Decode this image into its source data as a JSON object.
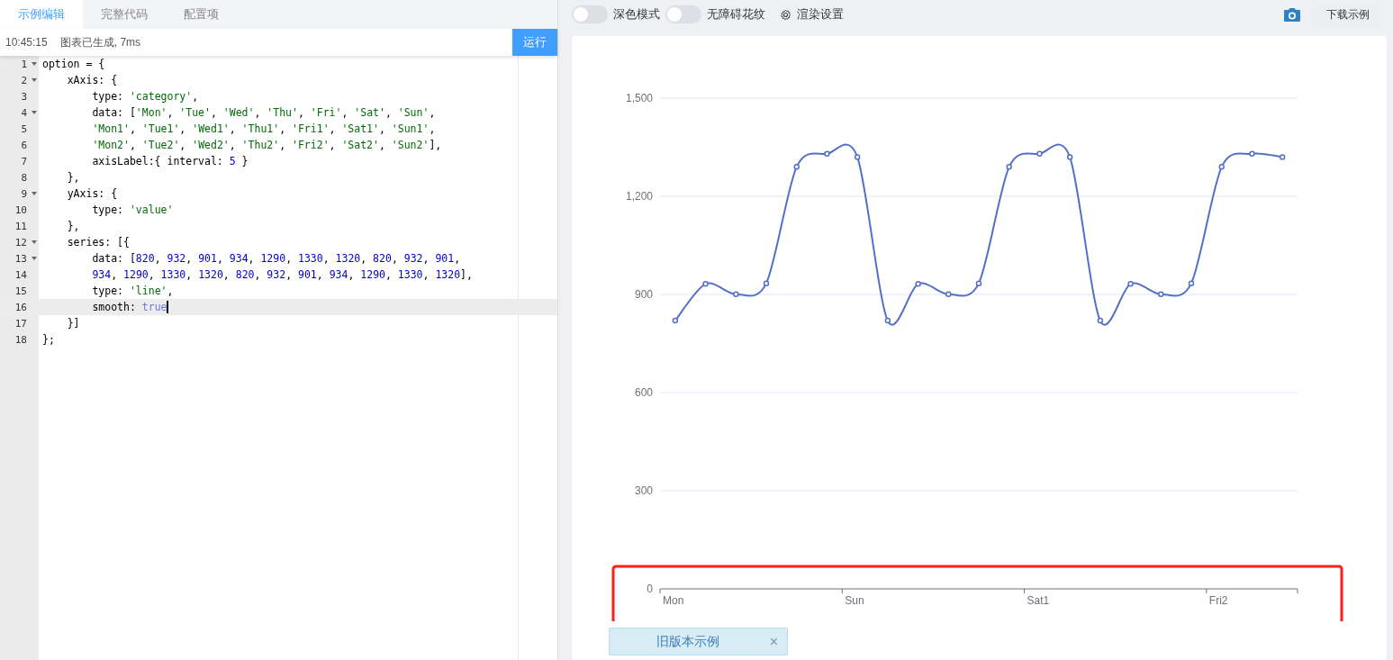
{
  "editor_tabs": [
    {
      "label": "示例编辑",
      "selected": true
    },
    {
      "label": "完整代码",
      "selected": false
    },
    {
      "label": "配置项",
      "selected": false
    }
  ],
  "status": {
    "time": "10:45:15",
    "message": "图表已生成, 7ms",
    "run_button": "运行"
  },
  "code_lines": [
    {
      "number": "1",
      "fold": true,
      "active": false,
      "tokens": [
        {
          "kind": "plain",
          "text": "option = {"
        }
      ]
    },
    {
      "number": "2",
      "fold": true,
      "active": false,
      "tokens": [
        {
          "kind": "plain",
          "text": "    xAxis: {"
        }
      ]
    },
    {
      "number": "3",
      "fold": false,
      "active": false,
      "tokens": [
        {
          "kind": "plain",
          "text": "        type: "
        },
        {
          "kind": "string",
          "text": "'category'"
        },
        {
          "kind": "plain",
          "text": ","
        }
      ]
    },
    {
      "number": "4",
      "fold": true,
      "active": false,
      "tokens": [
        {
          "kind": "plain",
          "text": "        data: ["
        },
        {
          "kind": "string",
          "text": "'Mon'"
        },
        {
          "kind": "plain",
          "text": ", "
        },
        {
          "kind": "string",
          "text": "'Tue'"
        },
        {
          "kind": "plain",
          "text": ", "
        },
        {
          "kind": "string",
          "text": "'Wed'"
        },
        {
          "kind": "plain",
          "text": ", "
        },
        {
          "kind": "string",
          "text": "'Thu'"
        },
        {
          "kind": "plain",
          "text": ", "
        },
        {
          "kind": "string",
          "text": "'Fri'"
        },
        {
          "kind": "plain",
          "text": ", "
        },
        {
          "kind": "string",
          "text": "'Sat'"
        },
        {
          "kind": "plain",
          "text": ", "
        },
        {
          "kind": "string",
          "text": "'Sun'"
        },
        {
          "kind": "plain",
          "text": ","
        }
      ]
    },
    {
      "number": "5",
      "fold": false,
      "active": false,
      "tokens": [
        {
          "kind": "string",
          "text": "        'Mon1'"
        },
        {
          "kind": "plain",
          "text": ", "
        },
        {
          "kind": "string",
          "text": "'Tue1'"
        },
        {
          "kind": "plain",
          "text": ", "
        },
        {
          "kind": "string",
          "text": "'Wed1'"
        },
        {
          "kind": "plain",
          "text": ", "
        },
        {
          "kind": "string",
          "text": "'Thu1'"
        },
        {
          "kind": "plain",
          "text": ", "
        },
        {
          "kind": "string",
          "text": "'Fri1'"
        },
        {
          "kind": "plain",
          "text": ", "
        },
        {
          "kind": "string",
          "text": "'Sat1'"
        },
        {
          "kind": "plain",
          "text": ", "
        },
        {
          "kind": "string",
          "text": "'Sun1'"
        },
        {
          "kind": "plain",
          "text": ","
        }
      ]
    },
    {
      "number": "6",
      "fold": false,
      "active": false,
      "tokens": [
        {
          "kind": "string",
          "text": "        'Mon2'"
        },
        {
          "kind": "plain",
          "text": ", "
        },
        {
          "kind": "string",
          "text": "'Tue2'"
        },
        {
          "kind": "plain",
          "text": ", "
        },
        {
          "kind": "string",
          "text": "'Wed2'"
        },
        {
          "kind": "plain",
          "text": ", "
        },
        {
          "kind": "string",
          "text": "'Thu2'"
        },
        {
          "kind": "plain",
          "text": ", "
        },
        {
          "kind": "string",
          "text": "'Fri2'"
        },
        {
          "kind": "plain",
          "text": ", "
        },
        {
          "kind": "string",
          "text": "'Sat2'"
        },
        {
          "kind": "plain",
          "text": ", "
        },
        {
          "kind": "string",
          "text": "'Sun2'"
        },
        {
          "kind": "plain",
          "text": "],"
        }
      ]
    },
    {
      "number": "7",
      "fold": false,
      "active": false,
      "tokens": [
        {
          "kind": "plain",
          "text": "        axisLabel:{ interval: "
        },
        {
          "kind": "number",
          "text": "5"
        },
        {
          "kind": "plain",
          "text": " }"
        }
      ]
    },
    {
      "number": "8",
      "fold": false,
      "active": false,
      "tokens": [
        {
          "kind": "plain",
          "text": "    },"
        }
      ]
    },
    {
      "number": "9",
      "fold": true,
      "active": false,
      "tokens": [
        {
          "kind": "plain",
          "text": "    yAxis: {"
        }
      ]
    },
    {
      "number": "10",
      "fold": false,
      "active": false,
      "tokens": [
        {
          "kind": "plain",
          "text": "        type: "
        },
        {
          "kind": "string",
          "text": "'value'"
        }
      ]
    },
    {
      "number": "11",
      "fold": false,
      "active": false,
      "tokens": [
        {
          "kind": "plain",
          "text": "    },"
        }
      ]
    },
    {
      "number": "12",
      "fold": true,
      "active": false,
      "tokens": [
        {
          "kind": "plain",
          "text": "    series: [{"
        }
      ]
    },
    {
      "number": "13",
      "fold": true,
      "active": false,
      "tokens": [
        {
          "kind": "plain",
          "text": "        data: ["
        },
        {
          "kind": "number",
          "text": "820"
        },
        {
          "kind": "plain",
          "text": ", "
        },
        {
          "kind": "number",
          "text": "932"
        },
        {
          "kind": "plain",
          "text": ", "
        },
        {
          "kind": "number",
          "text": "901"
        },
        {
          "kind": "plain",
          "text": ", "
        },
        {
          "kind": "number",
          "text": "934"
        },
        {
          "kind": "plain",
          "text": ", "
        },
        {
          "kind": "number",
          "text": "1290"
        },
        {
          "kind": "plain",
          "text": ", "
        },
        {
          "kind": "number",
          "text": "1330"
        },
        {
          "kind": "plain",
          "text": ", "
        },
        {
          "kind": "number",
          "text": "1320"
        },
        {
          "kind": "plain",
          "text": ", "
        },
        {
          "kind": "number",
          "text": "820"
        },
        {
          "kind": "plain",
          "text": ", "
        },
        {
          "kind": "number",
          "text": "932"
        },
        {
          "kind": "plain",
          "text": ", "
        },
        {
          "kind": "number",
          "text": "901"
        },
        {
          "kind": "plain",
          "text": ","
        }
      ]
    },
    {
      "number": "14",
      "fold": false,
      "active": false,
      "tokens": [
        {
          "kind": "number",
          "text": "        934"
        },
        {
          "kind": "plain",
          "text": ", "
        },
        {
          "kind": "number",
          "text": "1290"
        },
        {
          "kind": "plain",
          "text": ", "
        },
        {
          "kind": "number",
          "text": "1330"
        },
        {
          "kind": "plain",
          "text": ", "
        },
        {
          "kind": "number",
          "text": "1320"
        },
        {
          "kind": "plain",
          "text": ", "
        },
        {
          "kind": "number",
          "text": "820"
        },
        {
          "kind": "plain",
          "text": ", "
        },
        {
          "kind": "number",
          "text": "932"
        },
        {
          "kind": "plain",
          "text": ", "
        },
        {
          "kind": "number",
          "text": "901"
        },
        {
          "kind": "plain",
          "text": ", "
        },
        {
          "kind": "number",
          "text": "934"
        },
        {
          "kind": "plain",
          "text": ", "
        },
        {
          "kind": "number",
          "text": "1290"
        },
        {
          "kind": "plain",
          "text": ", "
        },
        {
          "kind": "number",
          "text": "1330"
        },
        {
          "kind": "plain",
          "text": ", "
        },
        {
          "kind": "number",
          "text": "1320"
        },
        {
          "kind": "plain",
          "text": "],"
        }
      ]
    },
    {
      "number": "15",
      "fold": false,
      "active": false,
      "tokens": [
        {
          "kind": "plain",
          "text": "        type: "
        },
        {
          "kind": "string",
          "text": "'line'"
        },
        {
          "kind": "plain",
          "text": ","
        }
      ]
    },
    {
      "number": "16",
      "fold": false,
      "active": true,
      "tokens": [
        {
          "kind": "plain",
          "text": "        smooth: "
        },
        {
          "kind": "keyword",
          "text": "true"
        }
      ]
    },
    {
      "number": "17",
      "fold": false,
      "active": false,
      "tokens": [
        {
          "kind": "plain",
          "text": "    }]"
        }
      ]
    },
    {
      "number": "18",
      "fold": false,
      "active": false,
      "tokens": [
        {
          "kind": "plain",
          "text": "};"
        }
      ]
    }
  ],
  "toolbar": {
    "toggles": [
      {
        "label": "深色模式",
        "on": false
      },
      {
        "label": "无障碍花纹",
        "on": false
      }
    ],
    "render_settings": "渲染设置",
    "download_button": "下载示例"
  },
  "chart": {
    "chart_data": {
      "type": "line",
      "categories": [
        "Mon",
        null,
        null,
        null,
        null,
        null,
        "Sun",
        null,
        null,
        null,
        null,
        null,
        "Sat1",
        null,
        null,
        null,
        null,
        null,
        "Fri2",
        null,
        null
      ],
      "series": [
        {
          "color": "#5470c6",
          "marker": true,
          "values": [
            820,
            932,
            901,
            934,
            1290,
            1330,
            1320,
            820,
            932,
            901,
            934,
            1290,
            1330,
            1320,
            820,
            932,
            901,
            934,
            1290,
            1330,
            1320
          ]
        }
      ],
      "grid": true,
      "ylim": [
        0,
        1500
      ],
      "yticks": [
        {
          "value": 0,
          "label": "0"
        },
        {
          "value": 300,
          "label": "300"
        },
        {
          "value": 600,
          "label": "600"
        },
        {
          "value": 900,
          "label": "900"
        },
        {
          "value": 1200,
          "label": "1,200"
        },
        {
          "value": 1500,
          "label": "1,500"
        }
      ]
    }
  },
  "notice": {
    "text": "旧版本示例",
    "close": "×"
  }
}
